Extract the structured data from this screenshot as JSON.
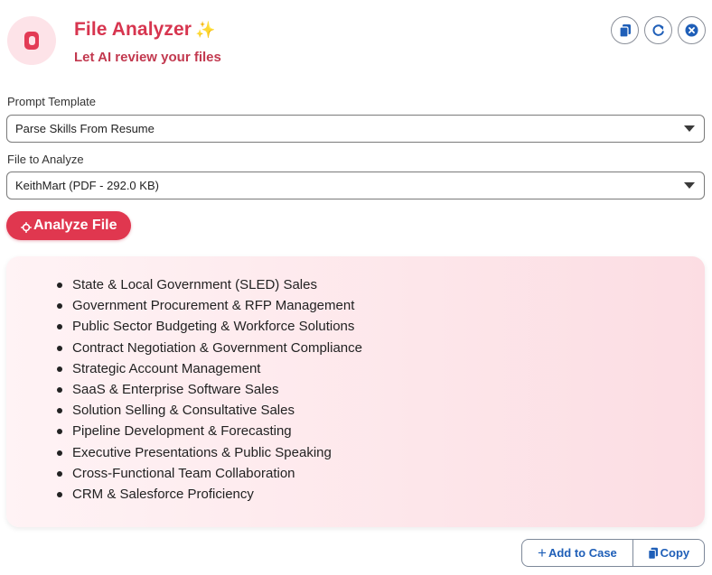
{
  "header": {
    "title": "File Analyzer",
    "title_emoji": "✨",
    "subtitle": "Let AI review your files",
    "actions": [
      {
        "name": "copy-all",
        "icon": "copy-icon"
      },
      {
        "name": "refresh",
        "icon": "refresh-icon"
      },
      {
        "name": "close",
        "icon": "close-icon"
      }
    ]
  },
  "form": {
    "prompt_label": "Prompt Template",
    "prompt_value": "Parse Skills From Resume",
    "file_label": "File to Analyze",
    "file_value": "KeithMart (PDF - 292.0 KB)",
    "analyze_label": "Analyze File"
  },
  "result": {
    "skills": [
      "State & Local Government (SLED) Sales",
      "Government Procurement & RFP Management",
      "Public Sector Budgeting & Workforce Solutions",
      "Contract Negotiation & Government Compliance",
      "Strategic Account Management",
      "SaaS & Enterprise Software Sales",
      "Solution Selling & Consultative Sales",
      "Pipeline Development & Forecasting",
      "Executive Presentations & Public Speaking",
      "Cross-Functional Team Collaboration",
      "CRM & Salesforce Proficiency"
    ]
  },
  "footer": {
    "add_label": "Add to Case",
    "copy_label": "Copy"
  },
  "colors": {
    "accent": "#e0374f",
    "title": "#d7354f",
    "link": "#1f5fb8",
    "panel": "#fde6ea"
  }
}
